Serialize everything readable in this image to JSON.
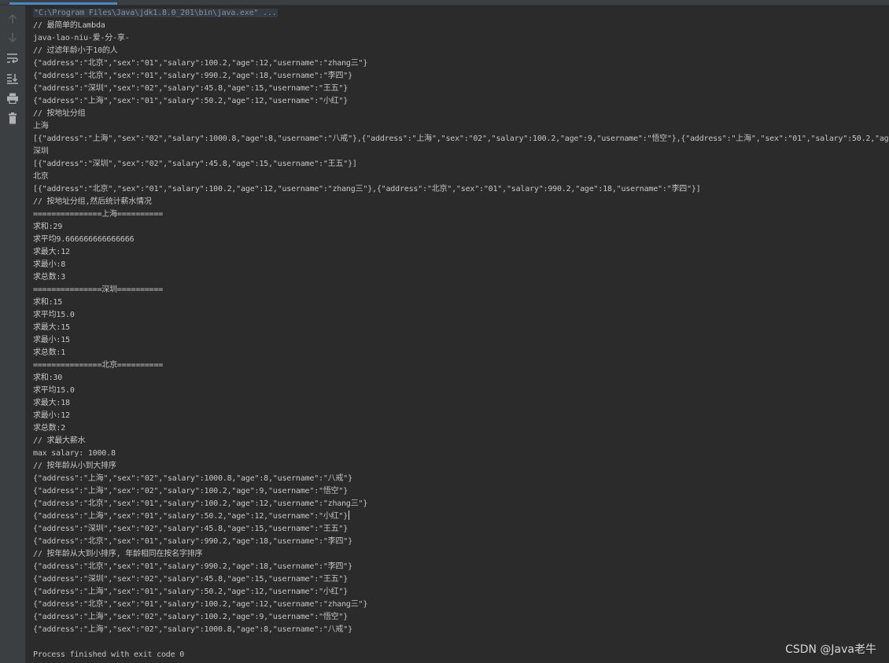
{
  "toolbar": {
    "icons": [
      "up-arrow-icon",
      "down-arrow-icon",
      "soft-wrap-icon",
      "scroll-to-end-icon",
      "print-icon",
      "trash-icon"
    ]
  },
  "console": {
    "command": "\"C:\\Program Files\\Java\\jdk1.8.0_201\\bin\\java.exe\" ...",
    "lines": [
      "// 最简单的Lambda",
      "java-lao-niu-爱-分-享-",
      "// 过滤年龄小于10的人",
      "{\"address\":\"北京\",\"sex\":\"01\",\"salary\":100.2,\"age\":12,\"username\":\"zhang三\"}",
      "{\"address\":\"北京\",\"sex\":\"01\",\"salary\":990.2,\"age\":18,\"username\":\"李四\"}",
      "{\"address\":\"深圳\",\"sex\":\"02\",\"salary\":45.8,\"age\":15,\"username\":\"王五\"}",
      "{\"address\":\"上海\",\"sex\":\"01\",\"salary\":50.2,\"age\":12,\"username\":\"小红\"}",
      "// 按地址分组",
      "上海",
      "[{\"address\":\"上海\",\"sex\":\"02\",\"salary\":1000.8,\"age\":8,\"username\":\"八戒\"},{\"address\":\"上海\",\"sex\":\"02\",\"salary\":100.2,\"age\":9,\"username\":\"悟空\"},{\"address\":\"上海\",\"sex\":\"01\",\"salary\":50.2,\"age\":12,\"username\":\"小红\"}]",
      "深圳",
      "[{\"address\":\"深圳\",\"sex\":\"02\",\"salary\":45.8,\"age\":15,\"username\":\"王五\"}]",
      "北京",
      "[{\"address\":\"北京\",\"sex\":\"01\",\"salary\":100.2,\"age\":12,\"username\":\"zhang三\"},{\"address\":\"北京\",\"sex\":\"01\",\"salary\":990.2,\"age\":18,\"username\":\"李四\"}]",
      "// 按地址分组,然后统计薪水情况",
      "===============上海==========",
      "求和:29",
      "求平均9.666666666666666",
      "求最大:12",
      "求最小:8",
      "求总数:3",
      "===============深圳==========",
      "求和:15",
      "求平均15.0",
      "求最大:15",
      "求最小:15",
      "求总数:1",
      "===============北京==========",
      "求和:30",
      "求平均15.0",
      "求最大:18",
      "求最小:12",
      "求总数:2",
      "// 求最大薪水",
      "max salary: 1000.8",
      "// 按年龄从小到大排序",
      "{\"address\":\"上海\",\"sex\":\"02\",\"salary\":1000.8,\"age\":8,\"username\":\"八戒\"}",
      "{\"address\":\"上海\",\"sex\":\"02\",\"salary\":100.2,\"age\":9,\"username\":\"悟空\"}",
      "{\"address\":\"北京\",\"sex\":\"01\",\"salary\":100.2,\"age\":12,\"username\":\"zhang三\"}",
      "{\"address\":\"上海\",\"sex\":\"01\",\"salary\":50.2,\"age\":12,\"username\":\"小红\"}",
      "{\"address\":\"深圳\",\"sex\":\"02\",\"salary\":45.8,\"age\":15,\"username\":\"王五\"}",
      "{\"address\":\"北京\",\"sex\":\"01\",\"salary\":990.2,\"age\":18,\"username\":\"李四\"}",
      "// 按年龄从大到小排序, 年龄相同在按名字排序",
      "{\"address\":\"北京\",\"sex\":\"01\",\"salary\":990.2,\"age\":18,\"username\":\"李四\"}",
      "{\"address\":\"深圳\",\"sex\":\"02\",\"salary\":45.8,\"age\":15,\"username\":\"王五\"}",
      "{\"address\":\"上海\",\"sex\":\"01\",\"salary\":50.2,\"age\":12,\"username\":\"小红\"}",
      "{\"address\":\"北京\",\"sex\":\"01\",\"salary\":100.2,\"age\":12,\"username\":\"zhang三\"}",
      "{\"address\":\"上海\",\"sex\":\"02\",\"salary\":100.2,\"age\":9,\"username\":\"悟空\"}",
      "{\"address\":\"上海\",\"sex\":\"02\",\"salary\":1000.8,\"age\":8,\"username\":\"八戒\"}",
      "",
      "Process finished with exit code 0"
    ],
    "caret_line": 39
  },
  "watermark": "CSDN @Java老牛",
  "colors": {
    "background": "#2b2b2b",
    "gutter": "#3c3f41",
    "text": "#c5c5c5",
    "command_text": "#8a9099",
    "accent": "#4a88c7"
  }
}
